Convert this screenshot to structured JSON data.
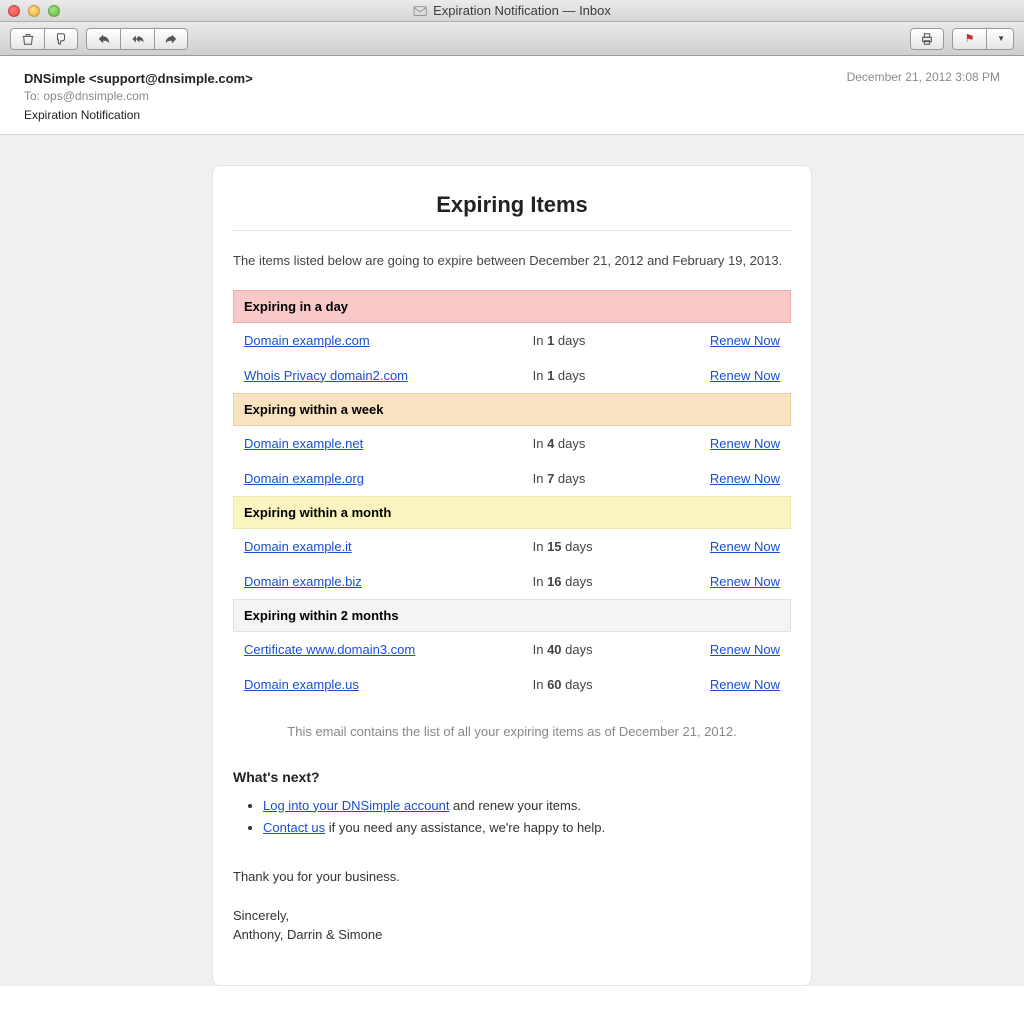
{
  "window": {
    "title": "Expiration Notification — Inbox"
  },
  "header": {
    "from": "DNSimple <support@dnsimple.com>",
    "to_label": "To:",
    "to": "ops@dnsimple.com",
    "subject": "Expiration Notification",
    "timestamp": "December 21, 2012 3:08 PM"
  },
  "email": {
    "title": "Expiring Items",
    "intro": "The items listed below are going to expire between December 21, 2012 and February 19, 2013.",
    "days_prefix": "In ",
    "days_suffix": " days",
    "renew_label": "Renew Now",
    "sections": [
      {
        "label": "Expiring in a day",
        "tone": "red",
        "items": [
          {
            "name": "Domain example.com",
            "days": "1"
          },
          {
            "name": "Whois Privacy domain2.com",
            "days": "1"
          }
        ]
      },
      {
        "label": "Expiring within a week",
        "tone": "orange",
        "items": [
          {
            "name": "Domain example.net",
            "days": "4"
          },
          {
            "name": "Domain example.org",
            "days": "7"
          }
        ]
      },
      {
        "label": "Expiring within a month",
        "tone": "yellow",
        "items": [
          {
            "name": "Domain example.it",
            "days": "15"
          },
          {
            "name": "Domain example.biz",
            "days": "16"
          }
        ]
      },
      {
        "label": "Expiring within 2 months",
        "tone": "gray",
        "items": [
          {
            "name": "Certificate www.domain3.com",
            "days": "40"
          },
          {
            "name": "Domain example.us",
            "days": "60"
          }
        ]
      }
    ],
    "footnote": "This email contains the list of all your expiring items as of December 21, 2012.",
    "whats_next_heading": "What's next?",
    "next_items": [
      {
        "link": "Log into your DNSimple account",
        "rest": " and renew your items."
      },
      {
        "link": "Contact us",
        "rest": " if you need any assistance, we're happy to help."
      }
    ],
    "thanks": "Thank you for your business.",
    "closing": "Sincerely,",
    "signature": "Anthony, Darrin & Simone"
  }
}
